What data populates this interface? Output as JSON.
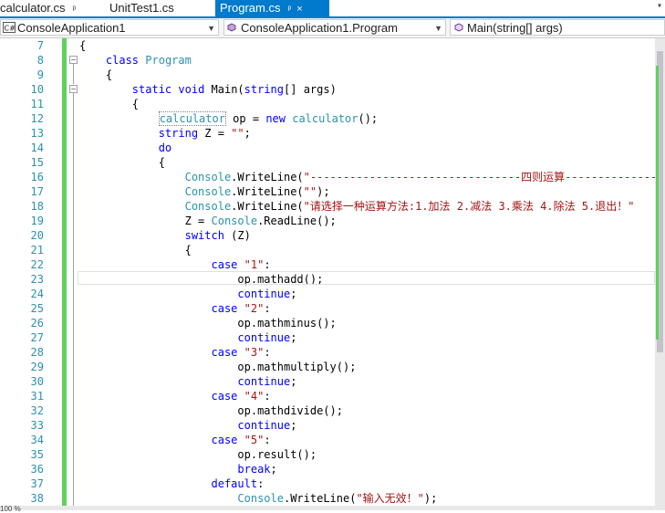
{
  "tabs": [
    {
      "label": "calculator.cs",
      "pin": "ᵖ",
      "active": false
    },
    {
      "label": "UnitTest1.cs",
      "active": false
    },
    {
      "label": "Program.cs",
      "pin": "ᵖ",
      "close": "×",
      "active": true
    }
  ],
  "navbar": {
    "project": "ConsoleApplication1",
    "class": "ConsoleApplication1.Program",
    "member": "Main(string[] args)"
  },
  "colors": {
    "accent": "#007acc",
    "keyword": "#0000ff",
    "type": "#2b91af",
    "string": "#a31515",
    "changed": "#5fd05f"
  },
  "editor": {
    "lines": [
      {
        "n": "7",
        "t": [
          [
            "p",
            "{"
          ]
        ]
      },
      {
        "n": "8",
        "t": [
          [
            "p",
            "    "
          ],
          [
            "kw",
            "class"
          ],
          [
            "p",
            " "
          ],
          [
            "ty",
            "Program"
          ]
        ]
      },
      {
        "n": "9",
        "t": [
          [
            "p",
            "    {"
          ]
        ]
      },
      {
        "n": "10",
        "t": [
          [
            "p",
            "        "
          ],
          [
            "kw",
            "static"
          ],
          [
            "p",
            " "
          ],
          [
            "kw",
            "void"
          ],
          [
            "p",
            " Main("
          ],
          [
            "kw",
            "string"
          ],
          [
            "p",
            "[] args)"
          ]
        ]
      },
      {
        "n": "11",
        "t": [
          [
            "p",
            "        {"
          ]
        ]
      },
      {
        "n": "12",
        "t": [
          [
            "p",
            "            "
          ],
          [
            "tyd",
            "calculator"
          ],
          [
            "p",
            " op = "
          ],
          [
            "kw",
            "new"
          ],
          [
            "p",
            " "
          ],
          [
            "ty",
            "calculator"
          ],
          [
            "p",
            "();"
          ]
        ]
      },
      {
        "n": "13",
        "t": [
          [
            "p",
            "            "
          ],
          [
            "kw",
            "string"
          ],
          [
            "p",
            " Z = "
          ],
          [
            "st",
            "\"\""
          ],
          [
            "p",
            ";"
          ]
        ]
      },
      {
        "n": "14",
        "t": [
          [
            "p",
            "            "
          ],
          [
            "kw",
            "do"
          ]
        ]
      },
      {
        "n": "15",
        "t": [
          [
            "p",
            "            {"
          ]
        ]
      },
      {
        "n": "16",
        "t": [
          [
            "p",
            "                "
          ],
          [
            "ty",
            "Console"
          ],
          [
            "p",
            ".WriteLine("
          ],
          [
            "st",
            "\"--------------------------------四则运算------------------------\""
          ]
        ]
      },
      {
        "n": "17",
        "t": [
          [
            "p",
            "                "
          ],
          [
            "ty",
            "Console"
          ],
          [
            "p",
            ".WriteLine("
          ],
          [
            "st",
            "\"\""
          ],
          [
            "p",
            ");"
          ]
        ]
      },
      {
        "n": "18",
        "t": [
          [
            "p",
            "                "
          ],
          [
            "ty",
            "Console"
          ],
          [
            "p",
            ".WriteLine("
          ],
          [
            "st",
            "\"请选择一种运算方法:1.加法 2.减法 3.乘法 4.除法 5.退出！\""
          ]
        ]
      },
      {
        "n": "19",
        "t": [
          [
            "p",
            "                Z = "
          ],
          [
            "ty",
            "Console"
          ],
          [
            "p",
            ".ReadLine();"
          ]
        ]
      },
      {
        "n": "20",
        "t": [
          [
            "p",
            "                "
          ],
          [
            "kw",
            "switch"
          ],
          [
            "p",
            " (Z)"
          ]
        ]
      },
      {
        "n": "21",
        "t": [
          [
            "p",
            "                {"
          ]
        ]
      },
      {
        "n": "22",
        "t": [
          [
            "p",
            "                    "
          ],
          [
            "kw",
            "case"
          ],
          [
            "p",
            " "
          ],
          [
            "st",
            "\"1\""
          ],
          [
            "p",
            ":"
          ]
        ]
      },
      {
        "n": "23",
        "t": [
          [
            "p",
            "                        op.mathadd();"
          ]
        ]
      },
      {
        "n": "24",
        "t": [
          [
            "p",
            "                        "
          ],
          [
            "kw",
            "continue"
          ],
          [
            "p",
            ";"
          ]
        ]
      },
      {
        "n": "25",
        "t": [
          [
            "p",
            "                    "
          ],
          [
            "kw",
            "case"
          ],
          [
            "p",
            " "
          ],
          [
            "st",
            "\"2\""
          ],
          [
            "p",
            ":"
          ]
        ]
      },
      {
        "n": "26",
        "t": [
          [
            "p",
            "                        op.mathminus();"
          ]
        ]
      },
      {
        "n": "27",
        "t": [
          [
            "p",
            "                        "
          ],
          [
            "kw",
            "continue"
          ],
          [
            "p",
            ";"
          ]
        ]
      },
      {
        "n": "28",
        "t": [
          [
            "p",
            "                    "
          ],
          [
            "kw",
            "case"
          ],
          [
            "p",
            " "
          ],
          [
            "st",
            "\"3\""
          ],
          [
            "p",
            ":"
          ]
        ]
      },
      {
        "n": "29",
        "t": [
          [
            "p",
            "                        op.mathmultiply();"
          ]
        ]
      },
      {
        "n": "30",
        "t": [
          [
            "p",
            "                        "
          ],
          [
            "kw",
            "continue"
          ],
          [
            "p",
            ";"
          ]
        ]
      },
      {
        "n": "31",
        "t": [
          [
            "p",
            "                    "
          ],
          [
            "kw",
            "case"
          ],
          [
            "p",
            " "
          ],
          [
            "st",
            "\"4\""
          ],
          [
            "p",
            ":"
          ]
        ]
      },
      {
        "n": "32",
        "t": [
          [
            "p",
            "                        op.mathdivide();"
          ]
        ]
      },
      {
        "n": "33",
        "t": [
          [
            "p",
            "                        "
          ],
          [
            "kw",
            "continue"
          ],
          [
            "p",
            ";"
          ]
        ]
      },
      {
        "n": "34",
        "t": [
          [
            "p",
            "                    "
          ],
          [
            "kw",
            "case"
          ],
          [
            "p",
            " "
          ],
          [
            "st",
            "\"5\""
          ],
          [
            "p",
            ":"
          ]
        ]
      },
      {
        "n": "35",
        "t": [
          [
            "p",
            "                        op.result();"
          ]
        ]
      },
      {
        "n": "36",
        "t": [
          [
            "p",
            "                        "
          ],
          [
            "kw",
            "break"
          ],
          [
            "p",
            ";"
          ]
        ]
      },
      {
        "n": "37",
        "t": [
          [
            "p",
            "                    "
          ],
          [
            "kw",
            "default"
          ],
          [
            "p",
            ":"
          ]
        ]
      },
      {
        "n": "38",
        "t": [
          [
            "p",
            "                        "
          ],
          [
            "ty",
            "Console"
          ],
          [
            "p",
            ".WriteLine("
          ],
          [
            "st",
            "\"输入无效！\""
          ],
          [
            "p",
            ");"
          ]
        ]
      }
    ]
  },
  "statusbar": {
    "zoom": "100 %"
  }
}
